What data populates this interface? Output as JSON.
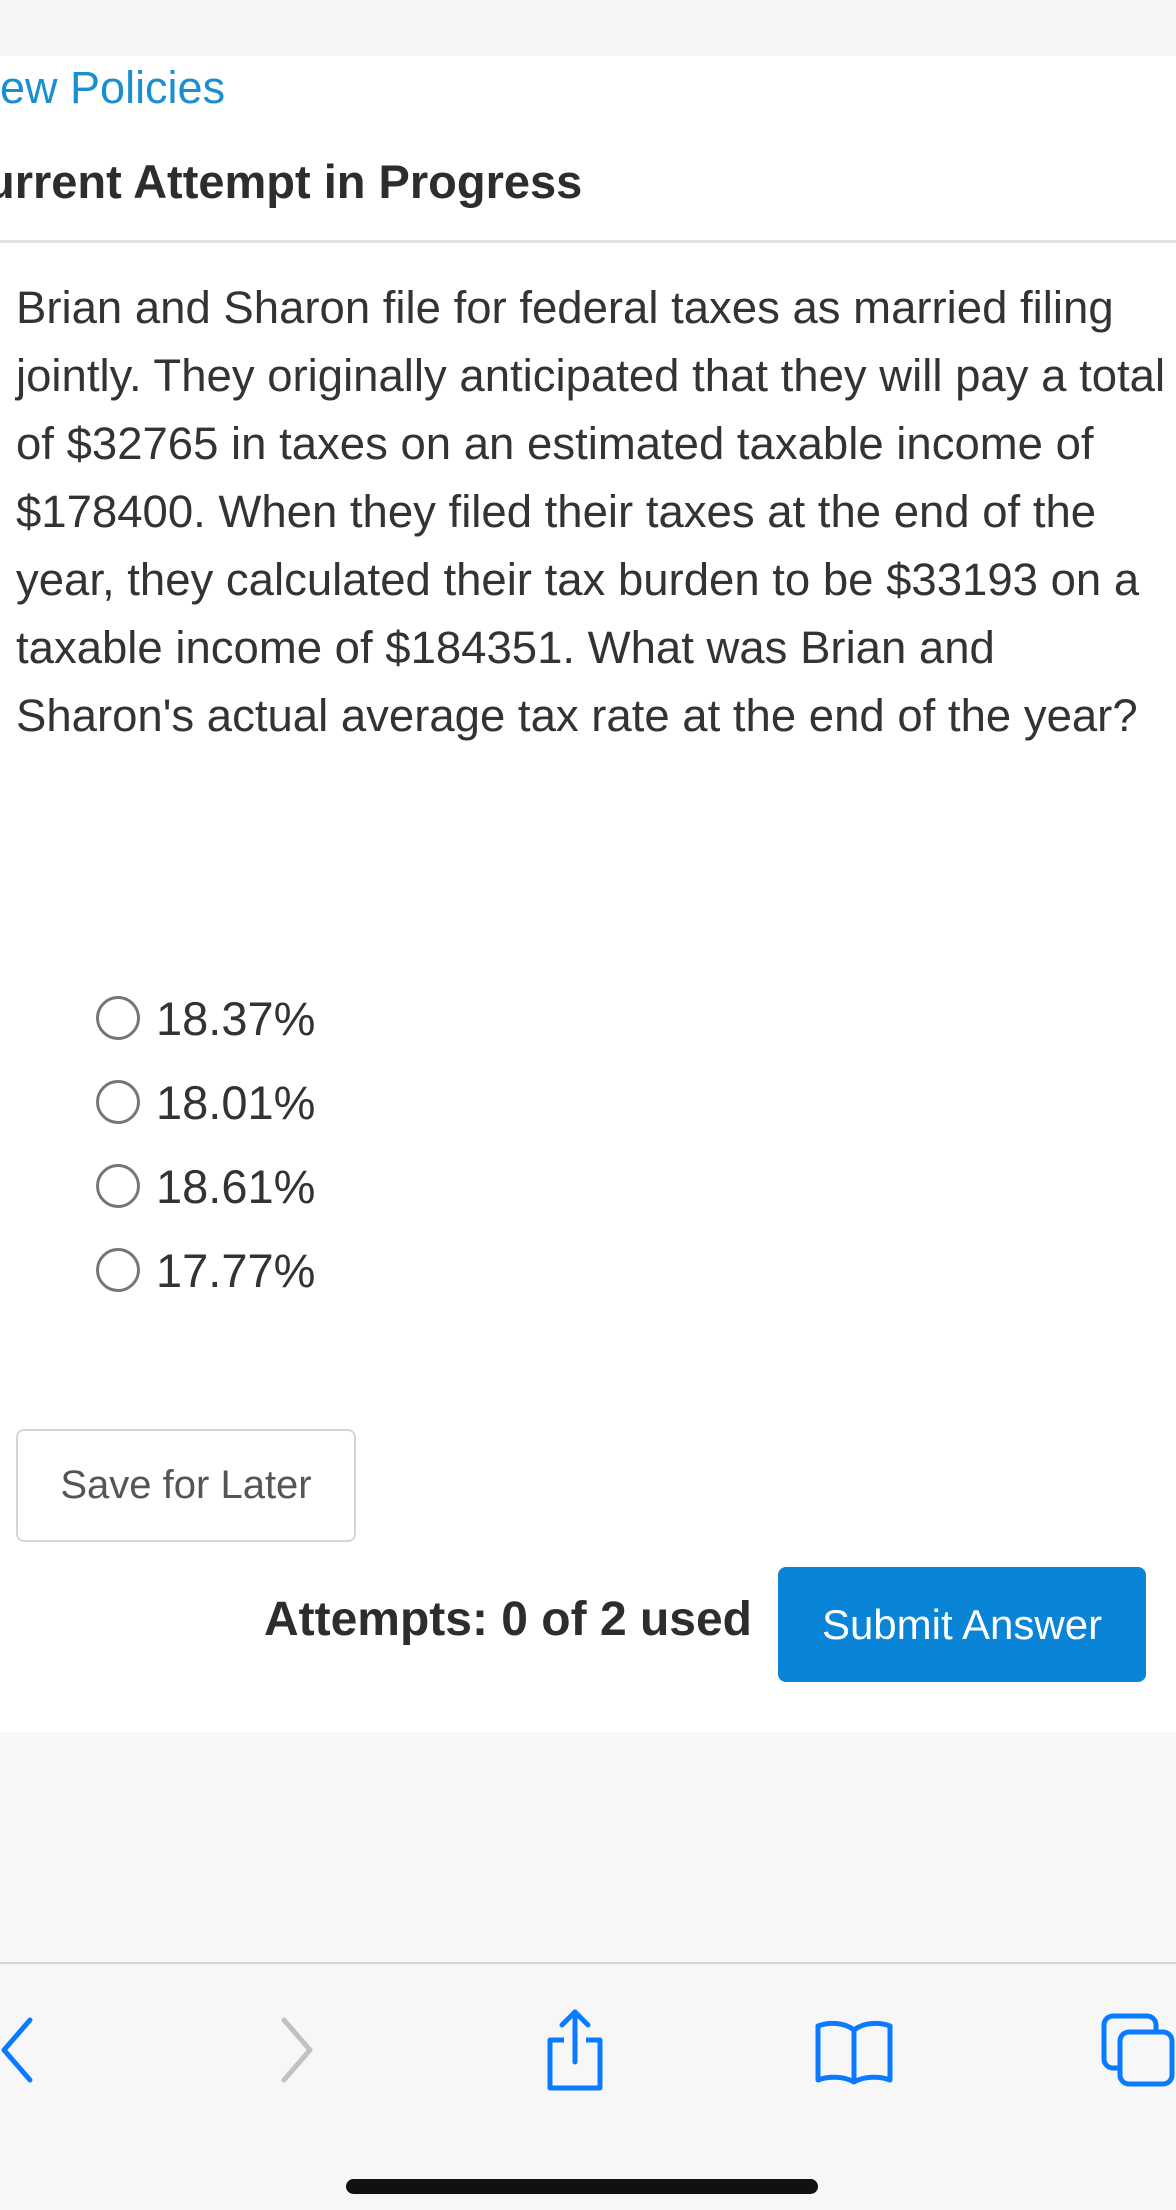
{
  "header": {
    "view_policies": "iew Policies",
    "attempt_status": "urrent Attempt in Progress"
  },
  "question": {
    "text": "Brian and Sharon file for federal taxes as married filing jointly. They originally anticipated that they will pay a total of $32765 in taxes on an estimated taxable income of $178400. When they filed their taxes at the end of the year, they calculated their tax burden to be $33193 on a taxable income of $184351. What was Brian and Sharon's actual average tax rate at the end of the year?"
  },
  "options": [
    {
      "label": "18.37%",
      "selected": false
    },
    {
      "label": "18.01%",
      "selected": false
    },
    {
      "label": "18.61%",
      "selected": false
    },
    {
      "label": "17.77%",
      "selected": false
    }
  ],
  "actions": {
    "save_label": "Save for Later",
    "attempts_label": "Attempts: 0 of 2 used",
    "submit_label": "Submit Answer"
  },
  "browser_toolbar": {
    "icons": [
      "back-icon",
      "forward-icon",
      "share-icon",
      "bookmarks-icon",
      "tabs-icon"
    ]
  },
  "colors": {
    "link": "#1a8fd0",
    "primary_button": "#0a84d6",
    "text": "#333333"
  }
}
